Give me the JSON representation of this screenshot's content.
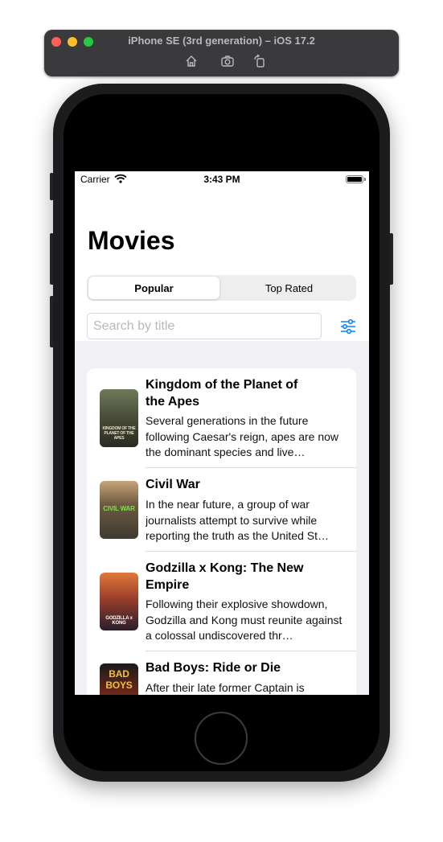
{
  "simulator": {
    "title": "iPhone SE (3rd generation) – iOS 17.2",
    "toolbar_icons": [
      "home-icon",
      "screenshot-icon",
      "rotate-icon"
    ]
  },
  "status_bar": {
    "carrier": "Carrier",
    "time": "3:43 PM"
  },
  "header": {
    "title": "Movies"
  },
  "segmented_control": {
    "options": [
      "Popular",
      "Top Rated"
    ],
    "selected": "Popular"
  },
  "search": {
    "placeholder": "Search by title",
    "value": ""
  },
  "colors": {
    "accent": "#0a84ff",
    "list_background": "#f0f0f5"
  },
  "movies": [
    {
      "title": "Kingdom of the Planet of the Apes",
      "overview": "Several generations in the future following Caesar's reign, apes are now the dominant species and live…",
      "poster_text": "KINGDOM OF THE PLANET OF THE APES"
    },
    {
      "title": "Civil War",
      "overview": "In the near future, a group of war journalists attempt to survive while reporting the truth as the United St…",
      "poster_text": "CIVIL WAR"
    },
    {
      "title": "Godzilla x Kong: The New Empire",
      "overview": "Following their explosive showdown, Godzilla and Kong must reunite against a colossal undiscovered thr…",
      "poster_text": "GODZILLA x KONG"
    },
    {
      "title": "Bad Boys: Ride or Die",
      "overview": "After their late former Captain is",
      "poster_text": "BAD BOYS"
    }
  ]
}
